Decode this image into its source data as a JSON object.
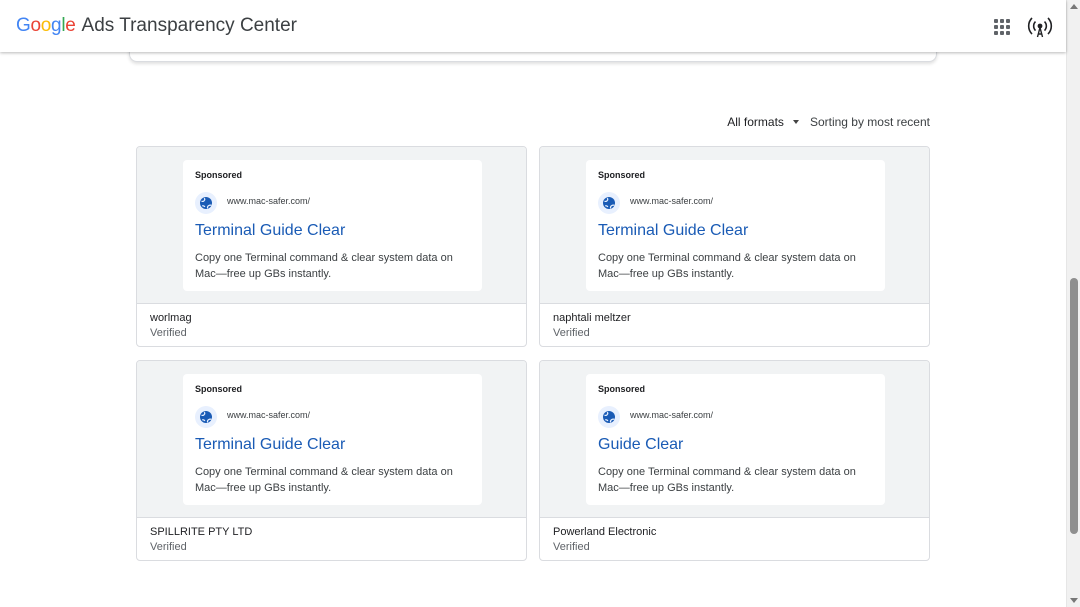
{
  "header": {
    "logo_letters": [
      {
        "char": "G",
        "color": "#4285F4"
      },
      {
        "char": "o",
        "color": "#EA4335"
      },
      {
        "char": "o",
        "color": "#FBBC05"
      },
      {
        "char": "g",
        "color": "#4285F4"
      },
      {
        "char": "l",
        "color": "#34A853"
      },
      {
        "char": "e",
        "color": "#EA4335"
      }
    ],
    "title": "Ads Transparency Center",
    "apps_icon": "apps-grid-icon",
    "account_icon": "broadcast-icon"
  },
  "toolbar": {
    "format_label": "All formats",
    "sort_label": "Sorting by most recent"
  },
  "ads": [
    {
      "sponsored": "Sponsored",
      "url": "www.mac-safer.com/",
      "headline": "Terminal Guide Clear",
      "description": "Copy one Terminal command & clear system data on Mac—free up GBs instantly.",
      "advertiser": "worlmag",
      "status": "Verified"
    },
    {
      "sponsored": "Sponsored",
      "url": "www.mac-safer.com/",
      "headline": "Terminal Guide Clear",
      "description": "Copy one Terminal command & clear system data on Mac—free up GBs instantly.",
      "advertiser": "naphtali meltzer",
      "status": "Verified"
    },
    {
      "sponsored": "Sponsored",
      "url": "www.mac-safer.com/",
      "headline": "Terminal Guide Clear",
      "description": "Copy one Terminal command & clear system data on Mac—free up GBs instantly.",
      "advertiser": "SPILLRITE PTY LTD",
      "status": "Verified"
    },
    {
      "sponsored": "Sponsored",
      "url": "www.mac-safer.com/",
      "headline": "Guide Clear",
      "description": "Copy one Terminal command & clear system data on Mac—free up GBs instantly.",
      "advertiser": "Powerland Electronic",
      "status": "Verified"
    }
  ],
  "colors": {
    "link_blue": "#1a5bb5",
    "preview_bg": "#f1f3f4",
    "border": "#dadce0"
  }
}
